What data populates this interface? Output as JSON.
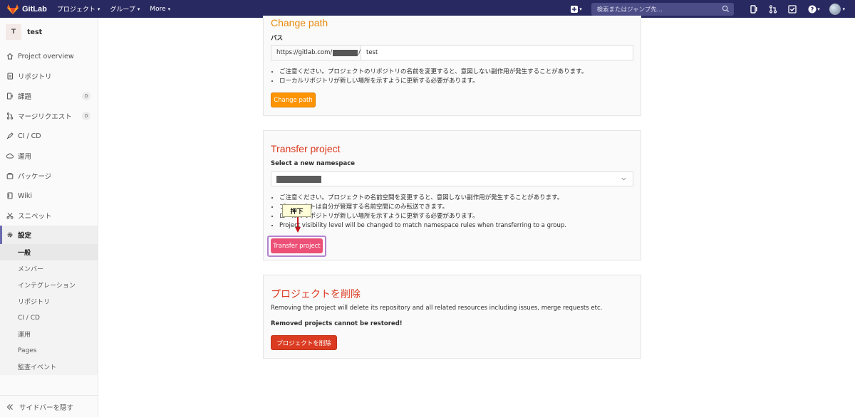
{
  "navbar": {
    "brand": "GitLab",
    "menus": [
      {
        "label": "プロジェクト"
      },
      {
        "label": "グループ"
      },
      {
        "label": "More"
      }
    ],
    "search_placeholder": "検索またはジャンプ先...",
    "colors": {
      "background": "#292961",
      "search_bg": "#4c4c87"
    }
  },
  "sidebar": {
    "project_initial": "T",
    "project_name": "test",
    "items": [
      {
        "label": "Project overview",
        "icon": "home-icon"
      },
      {
        "label": "リポジトリ",
        "icon": "doc-icon"
      },
      {
        "label": "課題",
        "icon": "issues-icon",
        "badge": "0"
      },
      {
        "label": "マージリクエスト",
        "icon": "merge-request-icon",
        "badge": "0"
      },
      {
        "label": "CI / CD",
        "icon": "rocket-icon"
      },
      {
        "label": "運用",
        "icon": "cloud-icon"
      },
      {
        "label": "パッケージ",
        "icon": "package-icon"
      },
      {
        "label": "Wiki",
        "icon": "book-icon"
      },
      {
        "label": "スニペット",
        "icon": "scissors-icon"
      },
      {
        "label": "設定",
        "icon": "gear-icon"
      }
    ],
    "settings_subitems": [
      "一般",
      "メンバー",
      "インテグレーション",
      "リポジトリ",
      "CI / CD",
      "運用",
      "Pages",
      "監査イベント"
    ],
    "collapse_label": "サイドバーを隠す"
  },
  "change_path": {
    "title": "Change path",
    "label": "パス",
    "url_prefix_start": "https://gitlab.com/",
    "url_prefix_end": "/",
    "path_value": "test",
    "notes": [
      "ご注意ください。プロジェクトのリポジトリの名前を変更すると、意図しない副作用が発生することがあります。",
      "ローカルリポジトリが新しい場所を示すように更新する必要があります。"
    ],
    "button": "Change path"
  },
  "transfer": {
    "title": "Transfer project",
    "label": "Select a new namespace",
    "notes": [
      "ご注意ください。プロジェクトの名前空間を変更すると、意図しない副作用が発生することがあります。",
      "プロジェクトは自分が管理する名前空間にのみ転送できます。",
      "ローカルリポジトリが新しい場所を示すように更新する必要があります。",
      "Project visibility level will be changed to match namespace rules when transferring to a group."
    ],
    "button": "Transfer project",
    "annotation": "押下"
  },
  "delete": {
    "title": "プロジェクトを削除",
    "description": "Removing the project will delete its repository and all related resources including issues, merge requests etc.",
    "warning": "Removed projects cannot be restored!",
    "button": "プロジェクトを削除"
  }
}
